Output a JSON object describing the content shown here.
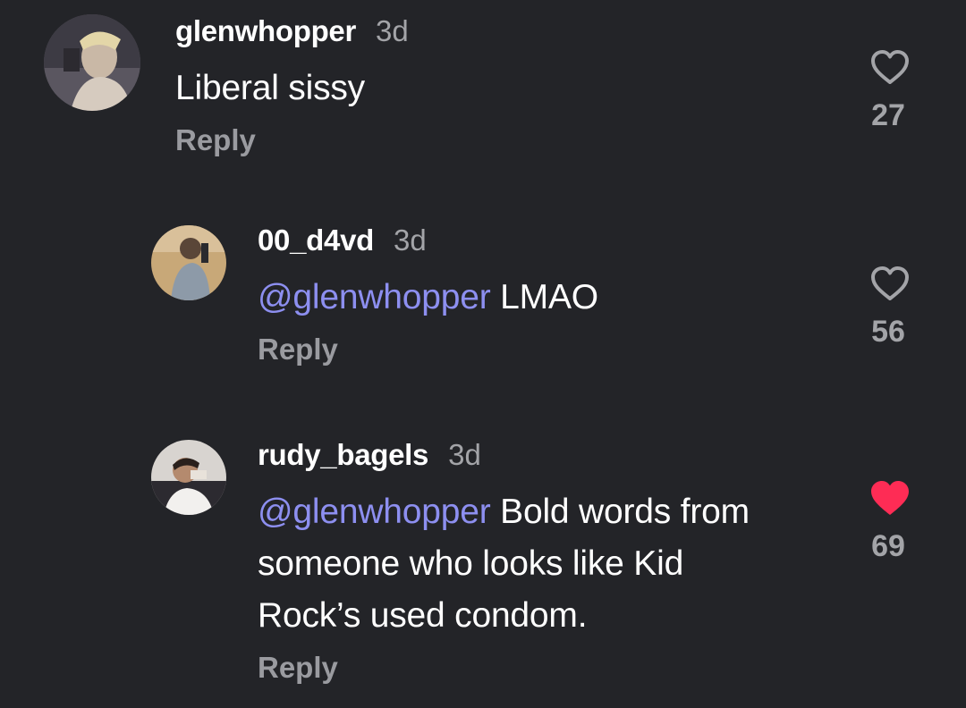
{
  "comments": [
    {
      "username": "glenwhopper",
      "time": "3d",
      "mention": "",
      "text": "Liberal sissy",
      "reply_label": "Reply",
      "likes": "27",
      "liked": false
    },
    {
      "username": "00_d4vd",
      "time": "3d",
      "mention": "@glenwhopper",
      "text": " LMAO",
      "reply_label": "Reply",
      "likes": "56",
      "liked": false
    },
    {
      "username": "rudy_bagels",
      "time": "3d",
      "mention": "@glenwhopper",
      "text": " Bold words from someone who looks like Kid Rock’s used condom.",
      "reply_label": "Reply",
      "likes": "69",
      "liked": true
    }
  ],
  "colors": {
    "background": "#232428",
    "mention": "#8d8ff0",
    "liked_heart": "#fe2c55",
    "muted_text": "#a3a4a8"
  },
  "icons": {
    "like_outline": "heart-outline-icon",
    "like_filled": "heart-filled-icon"
  }
}
